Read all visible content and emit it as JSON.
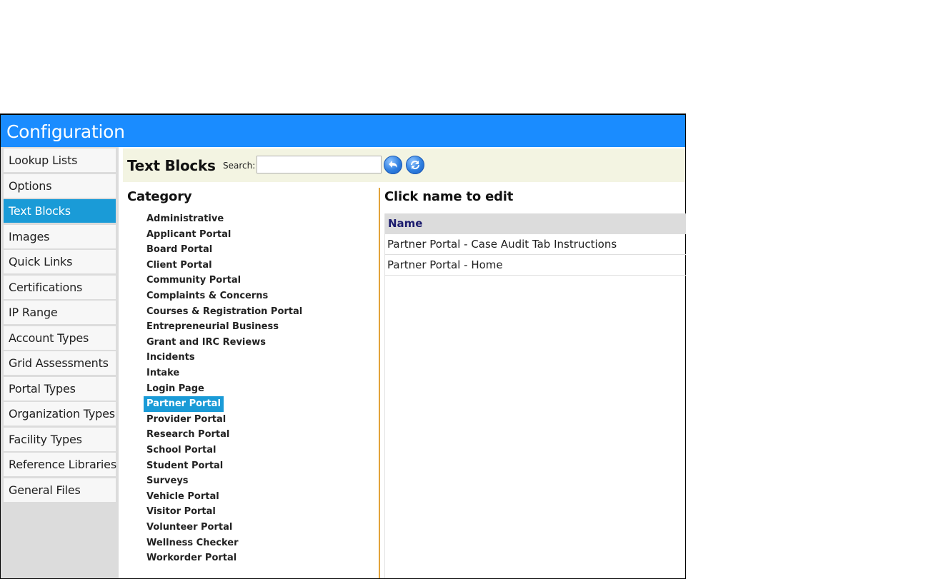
{
  "window": {
    "title": "Configuration"
  },
  "sidebar": {
    "active": "Text Blocks",
    "items": [
      {
        "label": "Lookup Lists"
      },
      {
        "label": "Options"
      },
      {
        "label": "Text Blocks"
      },
      {
        "label": "Images"
      },
      {
        "label": "Quick Links"
      },
      {
        "label": "Certifications"
      },
      {
        "label": "IP Range"
      },
      {
        "label": "Account Types"
      },
      {
        "label": "Grid Assessments"
      },
      {
        "label": "Portal Types"
      },
      {
        "label": "Organization Types"
      },
      {
        "label": "Facility Types"
      },
      {
        "label": "Reference Libraries"
      },
      {
        "label": "General Files"
      }
    ]
  },
  "toolbar": {
    "heading": "Text Blocks",
    "search_label": "Search:",
    "search_value": "",
    "back_icon": "back-arrow-icon",
    "refresh_icon": "refresh-icon"
  },
  "category": {
    "heading": "Category",
    "selected": "Partner Portal",
    "items": [
      {
        "label": "Administrative"
      },
      {
        "label": "Applicant Portal"
      },
      {
        "label": "Board Portal"
      },
      {
        "label": "Client Portal"
      },
      {
        "label": "Community Portal"
      },
      {
        "label": "Complaints & Concerns"
      },
      {
        "label": "Courses & Registration Portal"
      },
      {
        "label": "Entrepreneurial Business"
      },
      {
        "label": "Grant and IRC Reviews"
      },
      {
        "label": "Incidents"
      },
      {
        "label": "Intake"
      },
      {
        "label": "Login Page"
      },
      {
        "label": "Partner Portal"
      },
      {
        "label": "Provider Portal"
      },
      {
        "label": "Research Portal"
      },
      {
        "label": "School Portal"
      },
      {
        "label": "Student Portal"
      },
      {
        "label": "Surveys"
      },
      {
        "label": "Vehicle Portal"
      },
      {
        "label": "Visitor Portal"
      },
      {
        "label": "Volunteer Portal"
      },
      {
        "label": "Wellness Checker"
      },
      {
        "label": "Workorder Portal"
      }
    ]
  },
  "results": {
    "heading": "Click name to edit",
    "column_header": "Name",
    "rows": [
      {
        "name": "Partner Portal - Case Audit Tab Instructions"
      },
      {
        "name": "Partner Portal - Home"
      }
    ]
  },
  "colors": {
    "titlebar": "#1a8cff",
    "active_item": "#1a9bd7",
    "toolbar_bg": "#f3f4e2",
    "divider": "#e2a33a"
  }
}
